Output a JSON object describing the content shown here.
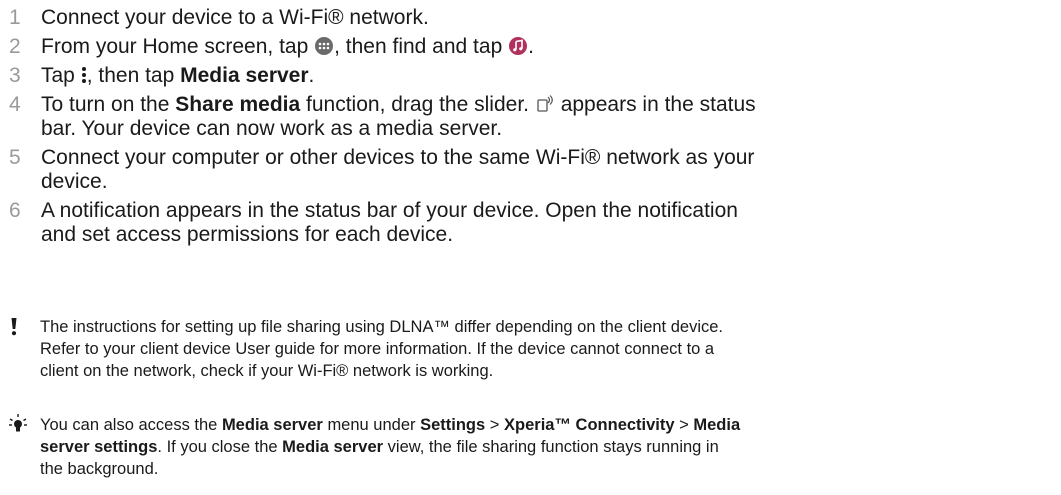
{
  "steps": [
    {
      "number": "1",
      "text": "Connect your device to a Wi-Fi® network."
    },
    {
      "number": "2",
      "part1": "From your Home screen, tap",
      "part2": ", then find and tap",
      "part3": ".",
      "icons": [
        "apps-grid-icon",
        "music-app-icon"
      ]
    },
    {
      "number": "3",
      "part1": "Tap",
      "part2": ", then tap",
      "bold1": "Media server",
      "part3": ".",
      "icons": [
        "overflow-menu-icon"
      ]
    },
    {
      "number": "4",
      "part1": "To turn on the",
      "bold1": "Share media",
      "part2": "function, drag the slider.",
      "part3": "appears in the status",
      "line2": "bar. Your device can now work as a media server.",
      "icons": [
        "media-share-status-icon"
      ]
    },
    {
      "number": "5",
      "line1": "Connect your computer or other devices to the same Wi-Fi® network as your",
      "line2": "device."
    },
    {
      "number": "6",
      "line1": "A notification appears in the status bar of your device. Open the notification",
      "line2": "and set access permissions for each device."
    }
  ],
  "note": {
    "icon": "exclamation-icon",
    "line1": "The instructions for setting up file sharing using DLNA™ differ depending on the client device.",
    "line2": "Refer to your client device User guide for more information. If the device cannot connect to a",
    "line3": "client on the network, check if your Wi-Fi® network is working."
  },
  "tip": {
    "icon": "lightbulb-icon",
    "t1": "You can also access the",
    "b1": "Media server",
    "t2": "menu under",
    "b2": "Settings",
    "t3": ">",
    "b3": "Xperia™ Connectivity",
    "t4": ">",
    "b4": "Media",
    "b5": "server settings",
    "t5": ". If you close the",
    "b6": "Media server",
    "t6": "view, the file sharing function stays running in",
    "t7": "the background."
  },
  "colors": {
    "step_number": "#9a9a9a",
    "text": "#1a1a1a",
    "music_icon": "#b2305d",
    "apps_icon": "#6a6a6a"
  }
}
